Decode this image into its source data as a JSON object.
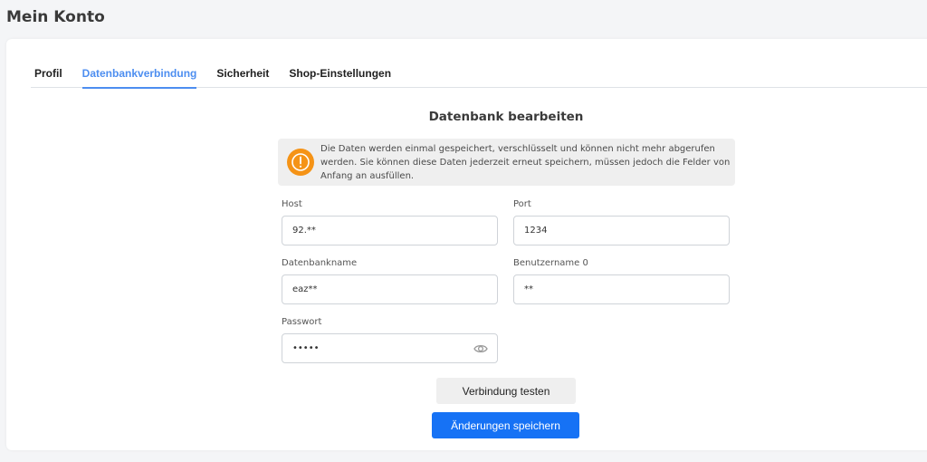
{
  "page": {
    "title": "Mein Konto"
  },
  "tabs": [
    {
      "label": "Profil"
    },
    {
      "label": "Datenbankverbindung",
      "active": true
    },
    {
      "label": "Sicherheit"
    },
    {
      "label": "Shop-Einstellungen"
    }
  ],
  "form": {
    "title": "Datenbank bearbeiten",
    "notice": "Die Daten werden einmal gespeichert, verschlüsselt und können nicht mehr abgerufen werden. Sie können diese Daten jederzeit erneut speichern, müssen jedoch die Felder von Anfang an ausfüllen.",
    "notice_icon": "warning-circle-icon",
    "host": {
      "label": "Host",
      "value": "92.**"
    },
    "port": {
      "label": "Port",
      "value": "1234"
    },
    "dbname": {
      "label": "Datenbankname",
      "value": "eaz**"
    },
    "username": {
      "label": "Benutzername 0",
      "value": "**"
    },
    "password": {
      "label": "Passwort",
      "value": "•••••"
    },
    "test_button": "Verbindung testen",
    "save_button": "Änderungen speichern"
  },
  "colors": {
    "accent": "#4d8ef0",
    "primary_button": "#1672f5",
    "warning": "#f59316"
  }
}
